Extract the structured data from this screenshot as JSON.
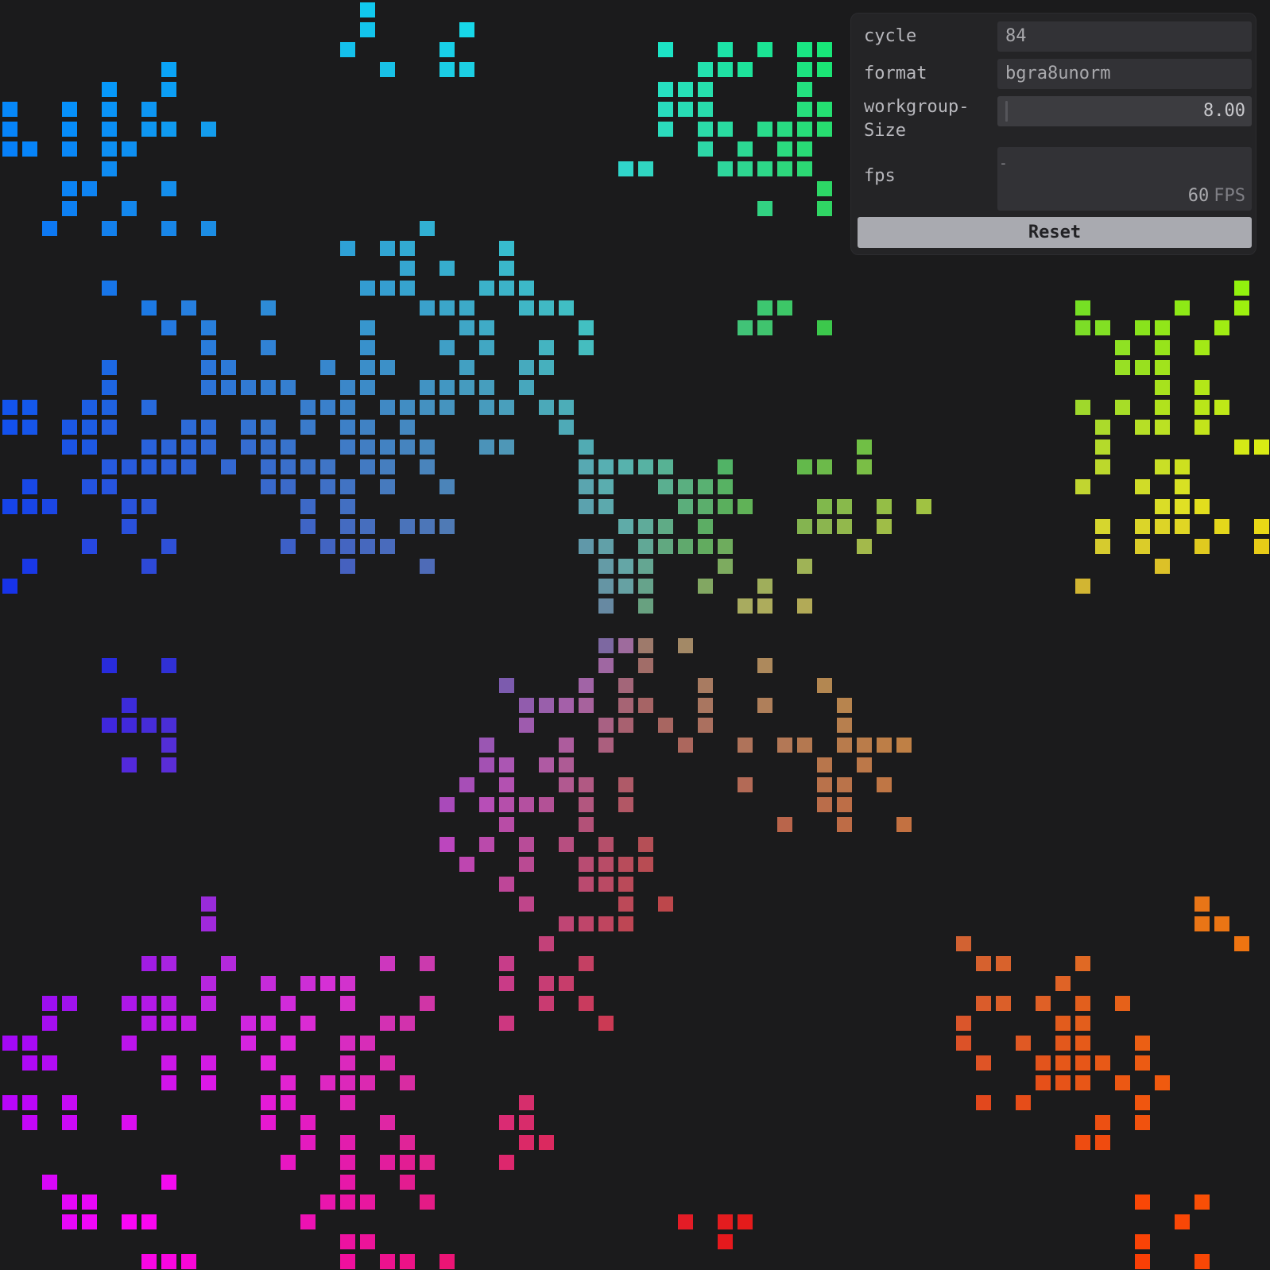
{
  "panel": {
    "cycle": {
      "label": "cycle",
      "value": "84"
    },
    "format": {
      "label": "format",
      "value": "bgra8unorm"
    },
    "workgroup_size": {
      "label_line1": "workgroup-",
      "label_line2": "Size",
      "value": "8.00"
    },
    "fps": {
      "label": "fps",
      "graph_marker": "-",
      "value": "60",
      "unit": "FPS"
    },
    "reset_label": "Reset"
  },
  "colors": {
    "background": "#1b1b1c",
    "panel_background": "#242426",
    "field_background": "#323236",
    "button_background": "#a9aab0",
    "cell_palette": "rainbow hue gradient (cyan top-left, green top, yellow/orange right, red bottom-right, violet/blue bottom-left, desaturated center)"
  },
  "icons": {
    "workgroup_slider_handle": "slider-handle-icon"
  }
}
